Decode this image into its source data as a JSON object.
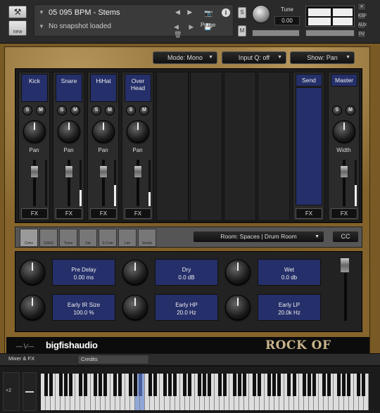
{
  "header": {
    "new_label": "new",
    "instrument_name": "05 095 BPM - Stems",
    "snapshot_text": "No snapshot loaded",
    "purge_label": "Purge",
    "s_label": "S",
    "m_label": "M",
    "tune_label": "Tune",
    "tune_value": "0.00",
    "side_buttons": [
      "KSP",
      "AUX",
      "PV"
    ]
  },
  "toolbar": {
    "mode_label": "Mode: Mono",
    "input_q_label": "Input Q: off",
    "show_label": "Show: Pan"
  },
  "channels": [
    {
      "name": "Kick",
      "pan_label": "Pan",
      "fx_label": "FX",
      "meter": 0.0
    },
    {
      "name": "Snare",
      "pan_label": "Pan",
      "fx_label": "FX",
      "meter": 0.35
    },
    {
      "name": "HiHat",
      "pan_label": "Pan",
      "fx_label": "FX",
      "meter": 0.45
    },
    {
      "name": "Over Head",
      "pan_label": "Pan",
      "fx_label": "FX",
      "meter": 0.3
    }
  ],
  "send": {
    "name": "Send",
    "fx_label": "FX"
  },
  "master": {
    "name": "Master",
    "width_label": "Width",
    "fx_label": "FX",
    "meter": 0.45
  },
  "channel_buttons": {
    "solo": "S",
    "mute": "M"
  },
  "fx_tabs": [
    "Conv",
    "SSEQ",
    "Trans",
    "Sat",
    "S-Com",
    "Lim",
    "Sends"
  ],
  "room_select": "Room: Spaces | Drum Room",
  "cc_label": "CC",
  "params": [
    {
      "label": "Pre Delay",
      "value": "0.00 ms"
    },
    {
      "label": "Dry",
      "value": "0.0 dB"
    },
    {
      "label": "Wet",
      "value": "0.0 db"
    },
    {
      "label": "Early IR Size",
      "value": "100.0 %"
    },
    {
      "label": "Early HP",
      "value": "20.0 Hz"
    },
    {
      "label": "Early LP",
      "value": "20.0k Hz"
    }
  ],
  "brand": {
    "company": "bigfishaudio",
    "product": "ROCK OF AGES"
  },
  "bottom_tabs": {
    "mixer": "Mixer & FX",
    "credits": "Credits"
  },
  "keyboard": {
    "pitch_label": "+2"
  }
}
